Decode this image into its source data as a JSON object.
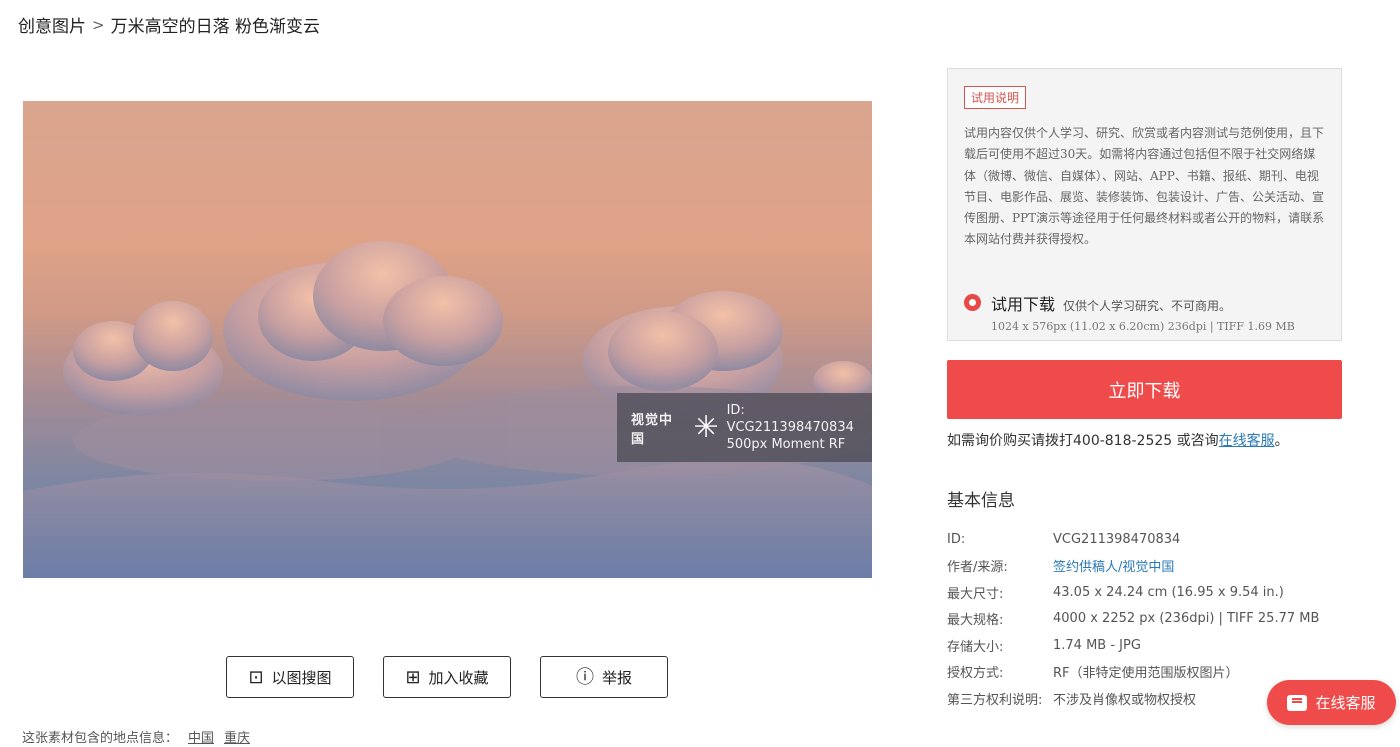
{
  "breadcrumb": {
    "root": "创意图片",
    "separator": ">",
    "title": "万米高空的日落 粉色渐变云"
  },
  "watermark": {
    "brand": "视觉中国",
    "id_line": "ID: VCG211398470834",
    "source_line": "500px Moment RF"
  },
  "actions": {
    "search_by_image": "以图搜图",
    "add_favorite": "加入收藏",
    "report": "举报"
  },
  "location": {
    "label": "这张素材包含的地点信息：",
    "places": [
      "中国",
      "重庆"
    ]
  },
  "trial": {
    "badge": "试用说明",
    "text": "试用内容仅供个人学习、研究、欣赏或者内容测试与范例使用，且下载后可使用不超过30天。如需将内容通过包括但不限于社交网络媒体（微博、微信、自媒体）、网站、APP、书籍、报纸、期刊、电视节目、电影作品、展览、装修装饰、包装设计、广告、公关活动、宣传图册、PPT演示等途径用于任何最终材料或者公开的物料，请联系本网站付费并获得授权。",
    "option_title": "试用下载",
    "option_desc": "仅供个人学习研究、不可商用。",
    "option_spec": "1024 x 576px (11.02 x 6.20cm) 236dpi | TIFF 1.69 MB"
  },
  "download_label": "立即下载",
  "contact": {
    "prefix": "如需询价购买请拨打400-818-2525 或咨询",
    "link": "在线客服",
    "suffix": "。"
  },
  "info": {
    "title": "基本信息",
    "rows": [
      {
        "label": "ID:",
        "value": "VCG211398470834"
      },
      {
        "label": "作者/来源:",
        "value": "签约供稿人/视觉中国"
      },
      {
        "label": "最大尺寸:",
        "value": "43.05 x 24.24 cm (16.95 x 9.54 in.)"
      },
      {
        "label": "最大规格:",
        "value": "4000 x 2252 px (236dpi) | TIFF 25.77 MB"
      },
      {
        "label": "存储大小:",
        "value": "1.74 MB - JPG"
      },
      {
        "label": "授权方式:",
        "value": "RF（非特定使用范围版权图片）"
      },
      {
        "label": "第三方权利说明:",
        "value": "不涉及肖像权或物权授权"
      }
    ]
  },
  "chat_label": "在线客服",
  "colors": {
    "accent_red": "#ef4b4b",
    "link_blue": "#2a7ab8"
  }
}
